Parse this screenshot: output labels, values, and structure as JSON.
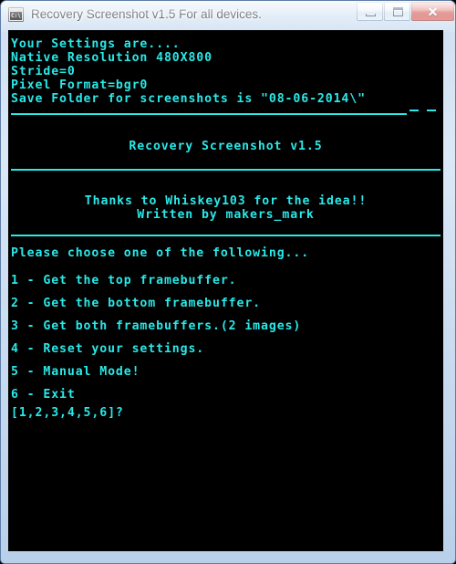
{
  "window": {
    "title": "Recovery Screenshot v1.5 For all devices.",
    "icon": "cmd-console-icon",
    "icon_text": "C:\\",
    "colors": {
      "console_bg": "#000000",
      "console_fg": "#2ae8e8",
      "frame": "#cfe0f2",
      "close_button": "#c4342f"
    }
  },
  "caption": {
    "minimize_label": "–",
    "maximize_label": "□",
    "close_label": "✕"
  },
  "console": {
    "settings_header": "Your Settings are....",
    "settings": [
      "Native Resolution 480X800",
      "Stride=0",
      "Pixel Format=bgr0",
      "Save Folder for screenshots is \"08-06-2014\\\""
    ],
    "trailing_dashes": "- -",
    "banner_title": "Recovery Screenshot v1.5",
    "credit_thanks": "Thanks to Whiskey103 for the idea!!",
    "credit_author": "Written by makers_mark",
    "menu_prompt": "Please choose one of the following...",
    "menu_items": [
      "1 - Get the top framebuffer.",
      "2 - Get the bottom framebuffer.",
      "3 - Get both framebuffers.(2 images)",
      "4 - Reset your settings.",
      "5 - Manual Mode!",
      "6 - Exit"
    ],
    "input_prompt": "[1,2,3,4,5,6]?"
  }
}
